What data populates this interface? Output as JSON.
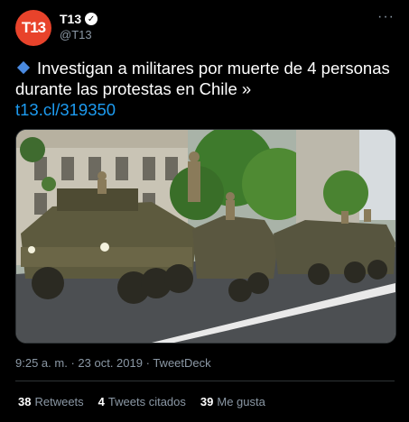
{
  "author": {
    "avatar_text": "T13",
    "display_name": "T13",
    "handle": "@T13",
    "verified_icon": "check-badge",
    "avatar_color": "#e8432b"
  },
  "tweet": {
    "text": "Investigan a militares por muerte de 4 personas durante las protestas en Chile »",
    "link": "t13.cl/319350",
    "bullet_icon": "blue-diamond",
    "link_color": "#1d9bf0"
  },
  "media": {
    "description_icon": "photo-armored-vehicles"
  },
  "meta": {
    "time": "9:25 a. m.",
    "separator": "·",
    "date": "23 oct. 2019",
    "source": "TweetDeck"
  },
  "stats": {
    "retweets_count": "38",
    "retweets_label": "Retweets",
    "quotes_count": "4",
    "quotes_label": "Tweets citados",
    "likes_count": "39",
    "likes_label": "Me gusta"
  }
}
